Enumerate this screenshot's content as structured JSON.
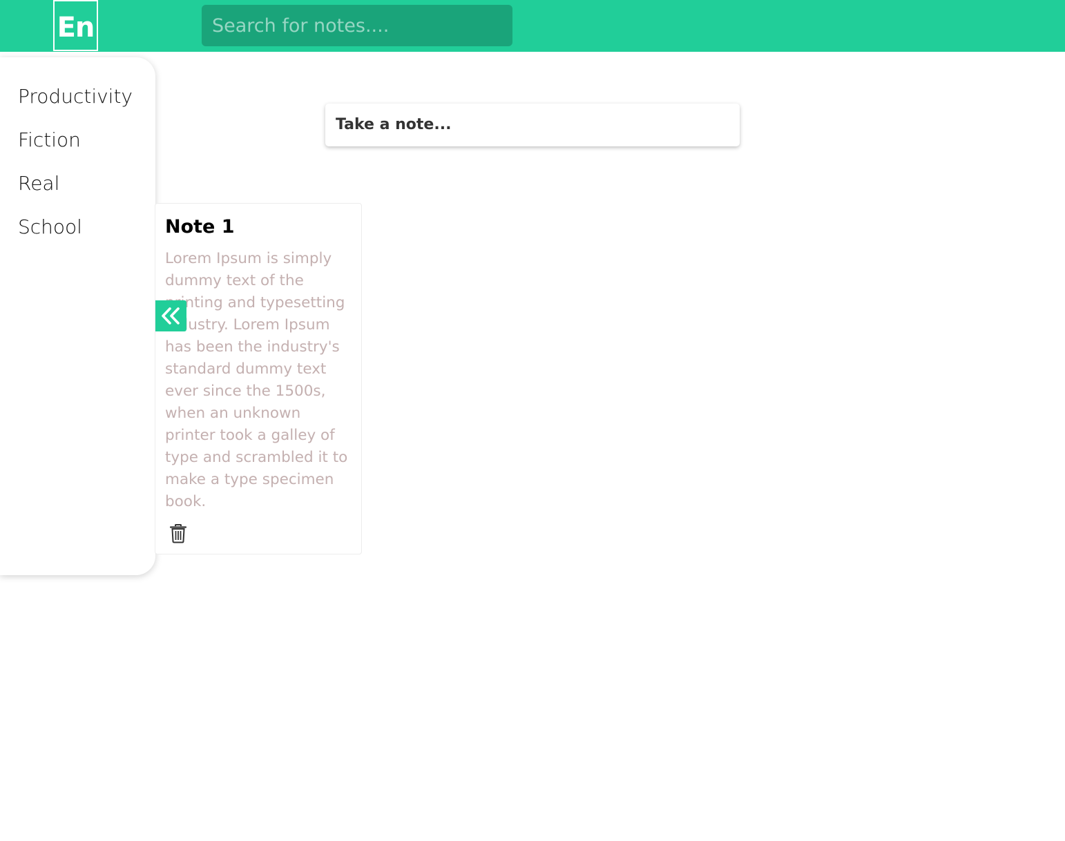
{
  "header": {
    "logo_text": "En",
    "search_placeholder": "Search for notes....",
    "background": "#21ce99"
  },
  "sidebar": {
    "items": [
      {
        "label": "Productivity"
      },
      {
        "label": "Fiction"
      },
      {
        "label": "Real"
      },
      {
        "label": "School"
      }
    ],
    "collapse_icon": "double-chevron-left-icon"
  },
  "composer": {
    "placeholder": "Take a note..."
  },
  "notes": [
    {
      "title": "Note 1",
      "body": "Lorem Ipsum is simply dummy text of the printing and typesetting industry. Lorem Ipsum has been the industry's standard dummy text ever since the 1500s, when an unknown printer took a galley of type and scrambled it to make a type specimen book.",
      "delete_icon": "trash-icon"
    }
  ]
}
